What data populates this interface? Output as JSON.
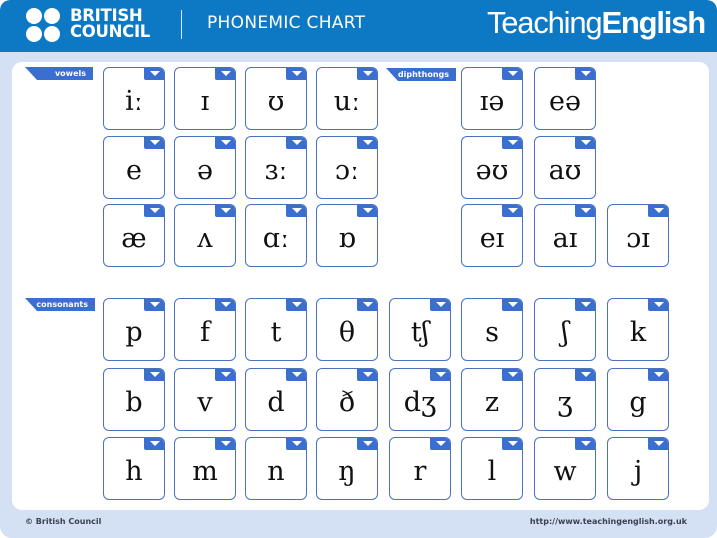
{
  "header": {
    "brand_line1": "BRITISH",
    "brand_line2": "COUNCIL",
    "title": "PHONEMIC CHART",
    "site_logo_light": "Teaching",
    "site_logo_bold": "English"
  },
  "colors": {
    "header_blue": "#0d79c4",
    "frame_light_blue": "#d4e1f4",
    "tile_border": "#4a72c0",
    "accent_blue": "#3a6fcf"
  },
  "sections": {
    "vowels_label": "vowels",
    "diphthongs_label": "diphthongs",
    "consonants_label": "consonants"
  },
  "vowels": [
    [
      "iː",
      "ɪ",
      "ʊ",
      "uː"
    ],
    [
      "e",
      "ə",
      "ɜː",
      "ɔː"
    ],
    [
      "æ",
      "ʌ",
      "ɑː",
      "ɒ"
    ]
  ],
  "diphthongs": [
    [
      "ɪə",
      "eə",
      ""
    ],
    [
      "əʊ",
      "aʊ",
      ""
    ],
    [
      "eɪ",
      "aɪ",
      "ɔɪ"
    ]
  ],
  "consonants": [
    [
      "p",
      "f",
      "t",
      "θ",
      "tʃ",
      "s",
      "ʃ",
      "k"
    ],
    [
      "b",
      "v",
      "d",
      "ð",
      "dʒ",
      "z",
      "ʒ",
      "g"
    ],
    [
      "h",
      "m",
      "n",
      "ŋ",
      "r",
      "l",
      "w",
      "j"
    ]
  ],
  "tile_icon": "dropdown-arrow-icon",
  "footer": {
    "copyright": "© British Council",
    "url": "http://www.teachingenglish.org.uk"
  }
}
